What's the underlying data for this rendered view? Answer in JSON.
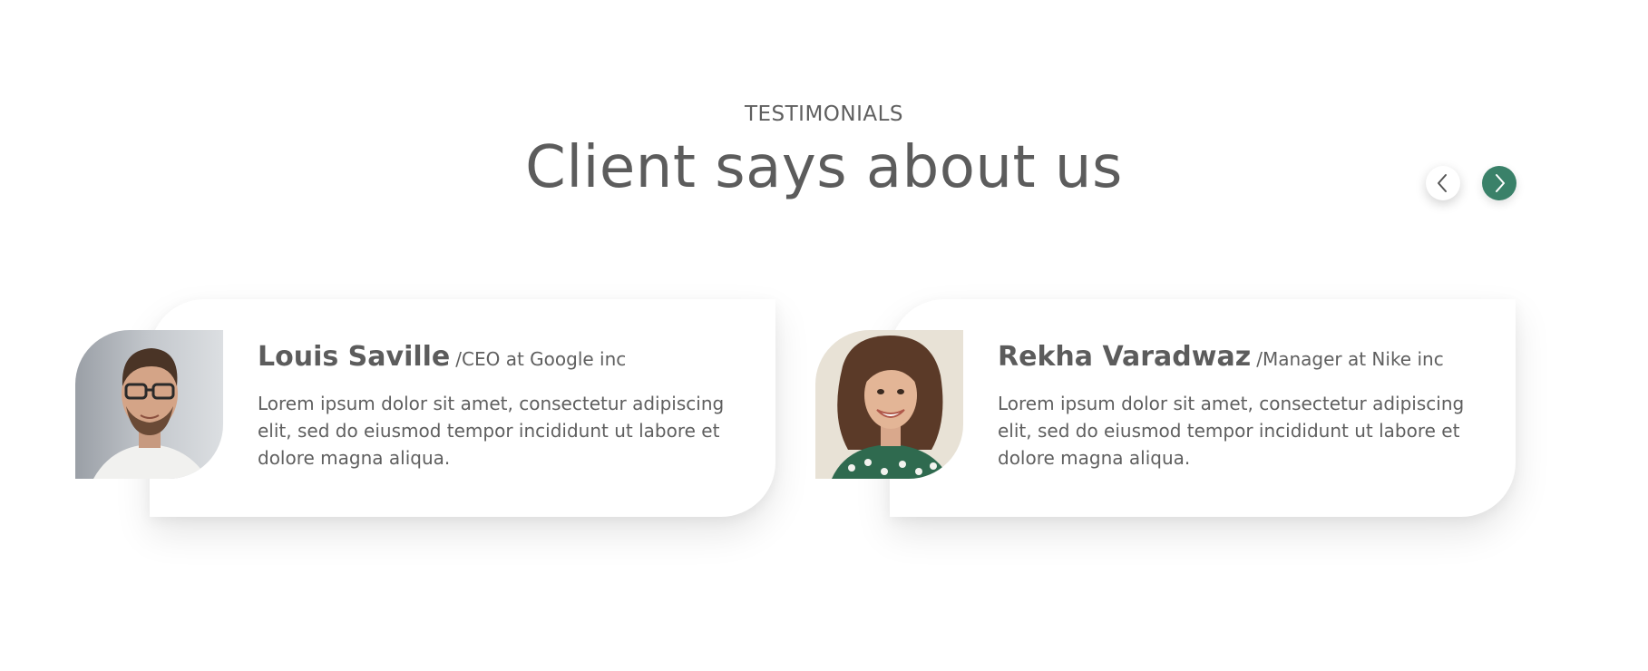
{
  "section": {
    "eyebrow": "TESTIMONIALS",
    "heading": "Client says about us"
  },
  "nav": {
    "prev_icon": "chevron-left-icon",
    "next_icon": "chevron-right-icon",
    "active_color": "#3a8169"
  },
  "testimonials": [
    {
      "name": "Louis Saville",
      "role": "/CEO at Google inc",
      "quote": "Lorem ipsum dolor sit amet, consectetur adipiscing elit, sed do eiusmod tempor incididunt ut labore et dolore magna aliqua.",
      "avatar": "man-with-glasses-photo"
    },
    {
      "name": "Rekha Varadwaz",
      "role": "/Manager at Nike inc",
      "quote": "Lorem ipsum dolor sit amet, consectetur adipiscing elit, sed do eiusmod tempor incididunt ut labore et dolore magna aliqua.",
      "avatar": "smiling-woman-photo"
    }
  ]
}
